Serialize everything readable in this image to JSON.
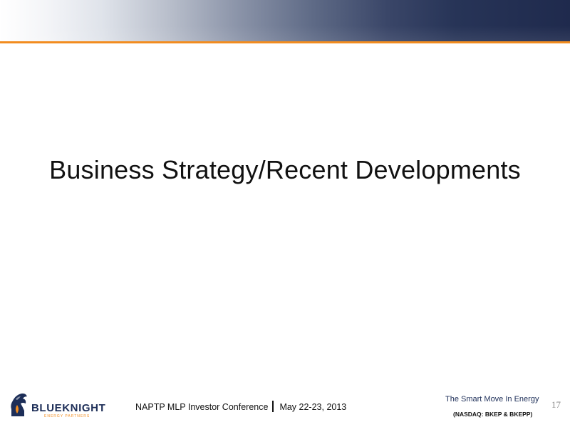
{
  "slide": {
    "title": "Business Strategy/Recent Developments",
    "page_number": "17"
  },
  "footer": {
    "conference": "NAPTP MLP Investor Conference",
    "date": "May 22-23, 2013",
    "tagline": "The Smart Move In Energy",
    "ticker": "(NASDAQ: BKEP & BKEPP)"
  },
  "logo": {
    "wordmark": "BLUEKNIGHT",
    "subtitle": "ENERGY PARTNERS",
    "icon": "knight-chess-piece-icon"
  },
  "colors": {
    "accent_orange": "#f28c1f",
    "brand_navy": "#1d2e58"
  }
}
